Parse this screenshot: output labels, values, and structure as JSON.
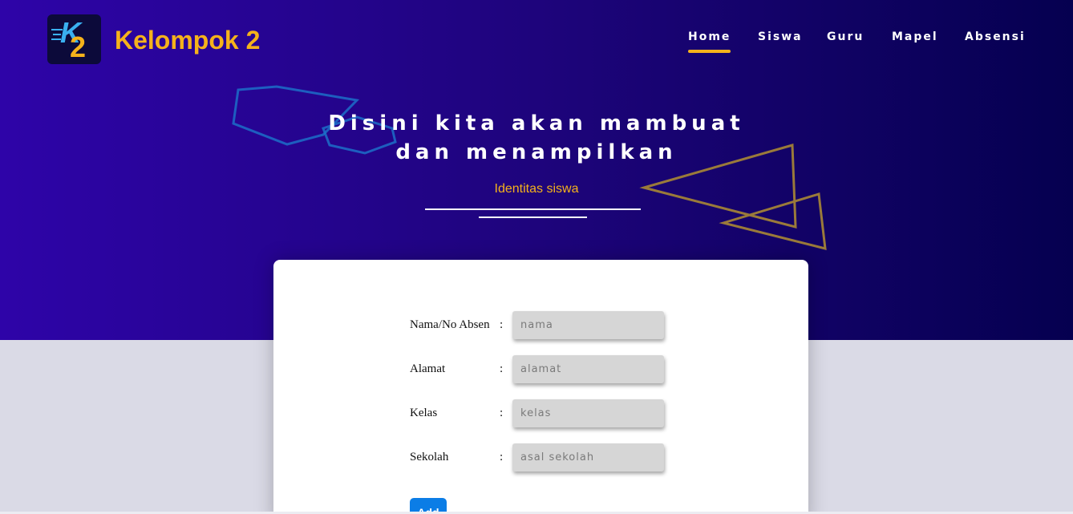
{
  "brand": {
    "logo_k": "K",
    "logo_2": "2",
    "name": "Kelompok 2"
  },
  "nav": {
    "items": [
      "Home",
      "Siswa",
      "Guru",
      "Mapel",
      "Absensi"
    ],
    "active": "Home"
  },
  "hero": {
    "headline_line1": "Disini kita akan mambuat",
    "headline_line2": "dan menampilkan",
    "subtitle": "Identitas siswa"
  },
  "form": {
    "fields": [
      {
        "label": "Nama/No Absen",
        "separator": ":",
        "placeholder": "nama",
        "value": ""
      },
      {
        "label": "Alamat",
        "separator": ":",
        "placeholder": "alamat",
        "value": ""
      },
      {
        "label": "Kelas",
        "separator": ":",
        "placeholder": "kelas",
        "value": ""
      },
      {
        "label": "Sekolah",
        "separator": ":",
        "placeholder": "asal sekolah",
        "value": ""
      }
    ],
    "submit_label": "Add"
  },
  "colors": {
    "accent": "#f5b21b",
    "hero_start": "#2e04a8",
    "hero_end": "#050050",
    "button": "#0b7de6",
    "page_bg": "#dadae6"
  }
}
